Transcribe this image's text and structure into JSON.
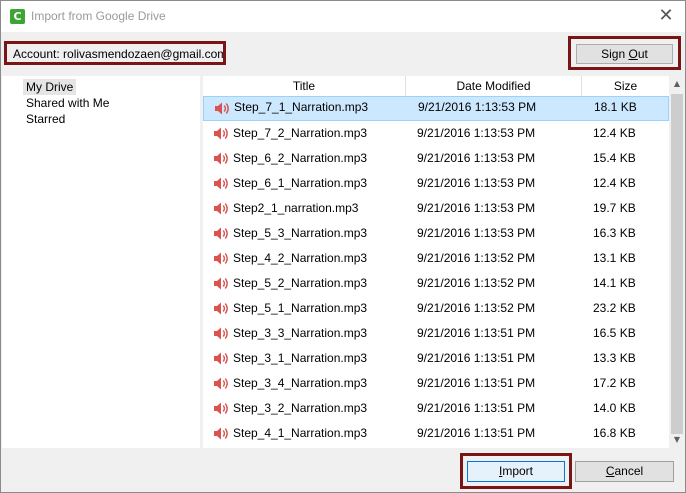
{
  "window": {
    "title": "Import from Google Drive",
    "app_icon_glyph": "C",
    "icons": {
      "app": "camtasia-app-icon",
      "close": "close-icon"
    }
  },
  "account": {
    "label": "Account: rolivasmendozaen@gmail.com",
    "sign_out": {
      "pre": "Sign ",
      "accel": "O",
      "post": "ut"
    }
  },
  "nav": {
    "items": [
      {
        "label": "My Drive",
        "selected": true
      },
      {
        "label": "Shared with Me",
        "selected": false
      },
      {
        "label": "Starred",
        "selected": false
      }
    ]
  },
  "table": {
    "columns": [
      "Title",
      "Date Modified",
      "Size"
    ],
    "row_icon": "speaker-icon",
    "rows": [
      {
        "title": "Step_7_1_Narration.mp3",
        "date": "9/21/2016 1:13:53 PM",
        "size": "18.1 KB",
        "selected": true
      },
      {
        "title": "Step_7_2_Narration.mp3",
        "date": "9/21/2016 1:13:53 PM",
        "size": "12.4 KB"
      },
      {
        "title": "Step_6_2_Narration.mp3",
        "date": "9/21/2016 1:13:53 PM",
        "size": "15.4 KB"
      },
      {
        "title": "Step_6_1_Narration.mp3",
        "date": "9/21/2016 1:13:53 PM",
        "size": "12.4 KB"
      },
      {
        "title": "Step2_1_narration.mp3",
        "date": "9/21/2016 1:13:53 PM",
        "size": "19.7 KB"
      },
      {
        "title": "Step_5_3_Narration.mp3",
        "date": "9/21/2016 1:13:53 PM",
        "size": "16.3 KB"
      },
      {
        "title": "Step_4_2_Narration.mp3",
        "date": "9/21/2016 1:13:52 PM",
        "size": "13.1 KB"
      },
      {
        "title": "Step_5_2_Narration.mp3",
        "date": "9/21/2016 1:13:52 PM",
        "size": "14.1 KB"
      },
      {
        "title": "Step_5_1_Narration.mp3",
        "date": "9/21/2016 1:13:52 PM",
        "size": "23.2 KB"
      },
      {
        "title": "Step_3_3_Narration.mp3",
        "date": "9/21/2016 1:13:51 PM",
        "size": "16.5 KB"
      },
      {
        "title": "Step_3_1_Narration.mp3",
        "date": "9/21/2016 1:13:51 PM",
        "size": "13.3 KB"
      },
      {
        "title": "Step_3_4_Narration.mp3",
        "date": "9/21/2016 1:13:51 PM",
        "size": "17.2 KB"
      },
      {
        "title": "Step_3_2_Narration.mp3",
        "date": "9/21/2016 1:13:51 PM",
        "size": "14.0 KB"
      },
      {
        "title": "Step_4_1_Narration.mp3",
        "date": "9/21/2016 1:13:51 PM",
        "size": "16.8 KB"
      }
    ]
  },
  "buttons": {
    "import": {
      "accel": "I",
      "post": "mport"
    },
    "cancel": {
      "accel": "C",
      "post": "ancel"
    }
  },
  "colors": {
    "highlight_border": "#7a1515",
    "selection": "#cce8ff",
    "speaker_icon": "#d9534f",
    "app_icon": "#3ea535"
  }
}
